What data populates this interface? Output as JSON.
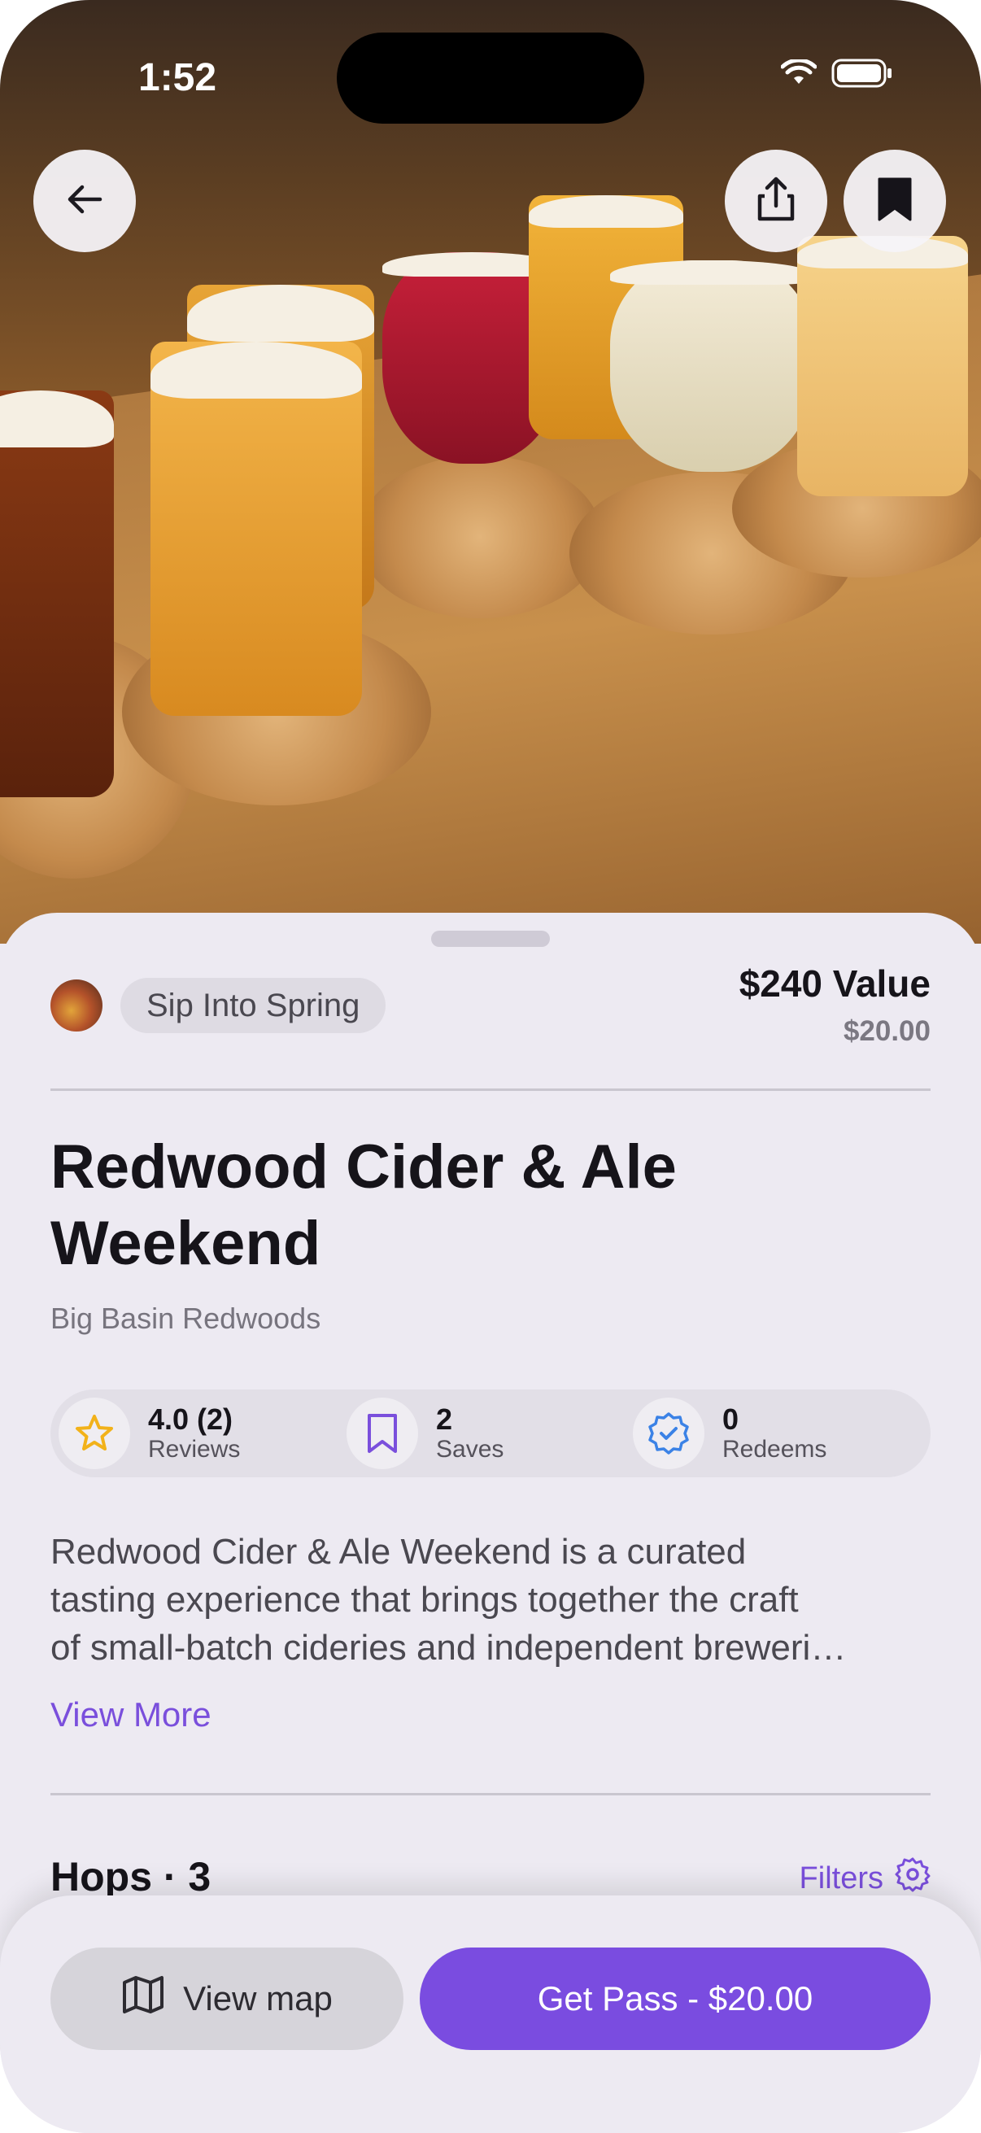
{
  "status_bar": {
    "time": "1:52"
  },
  "header": {
    "back_icon": "arrow-left-icon",
    "share_icon": "share-icon",
    "bookmark_icon": "bookmark-filled-icon"
  },
  "deal": {
    "collection_tag": "Sip Into Spring",
    "value_label": "$240 Value",
    "price": "$20.00",
    "title": "Redwood Cider & Ale Weekend",
    "location": "Big Basin Redwoods"
  },
  "stats": [
    {
      "icon": "star-icon",
      "value": "4.0 (2)",
      "label": "Reviews",
      "color": "#f2b21a"
    },
    {
      "icon": "bookmark-outline-icon",
      "value": "2",
      "label": "Saves",
      "color": "#7a4fdc"
    },
    {
      "icon": "verified-badge-icon",
      "value": "0",
      "label": "Redeems",
      "color": "#3b82e6"
    }
  ],
  "description": {
    "lines": [
      "Redwood Cider & Ale Weekend is a curated",
      "tasting experience that brings together the craft",
      "of small-batch cideries and independent breweri…"
    ],
    "view_more": "View More"
  },
  "hops": {
    "title": "Hops · 3",
    "filters_label": "Filters",
    "filters_icon": "gear-icon"
  },
  "actions": {
    "view_map": "View map",
    "map_icon": "map-icon",
    "get_pass": "Get Pass - $20.00"
  },
  "colors": {
    "accent": "#7a4ce0",
    "background": "#edeaf2"
  }
}
